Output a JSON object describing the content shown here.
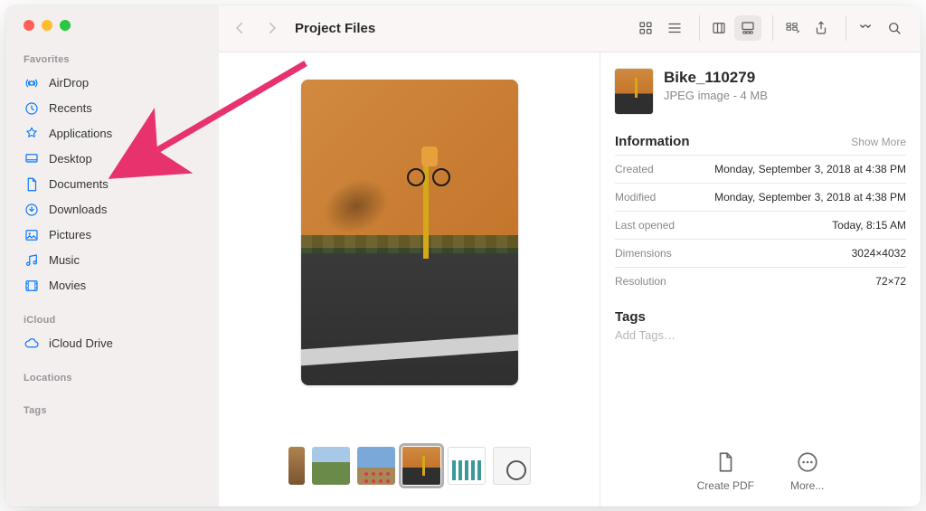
{
  "window_title": "Project Files",
  "sidebar": {
    "sections": [
      {
        "label": "Favorites",
        "items": [
          {
            "icon": "airdrop-icon",
            "label": "AirDrop"
          },
          {
            "icon": "recents-icon",
            "label": "Recents"
          },
          {
            "icon": "applications-icon",
            "label": "Applications"
          },
          {
            "icon": "desktop-icon",
            "label": "Desktop"
          },
          {
            "icon": "documents-icon",
            "label": "Documents"
          },
          {
            "icon": "downloads-icon",
            "label": "Downloads"
          },
          {
            "icon": "pictures-icon",
            "label": "Pictures"
          },
          {
            "icon": "music-icon",
            "label": "Music"
          },
          {
            "icon": "movies-icon",
            "label": "Movies"
          }
        ]
      },
      {
        "label": "iCloud",
        "items": [
          {
            "icon": "icloud-icon",
            "label": "iCloud Drive"
          }
        ]
      },
      {
        "label": "Locations",
        "items": []
      },
      {
        "label": "Tags",
        "items": []
      }
    ]
  },
  "inspector": {
    "file_name": "Bike_110279",
    "file_sub": "JPEG image - 4 MB",
    "info_heading": "Information",
    "show_more": "Show More",
    "rows": [
      {
        "k": "Created",
        "v": "Monday, September 3, 2018 at 4:38 PM"
      },
      {
        "k": "Modified",
        "v": "Monday, September 3, 2018 at 4:38 PM"
      },
      {
        "k": "Last opened",
        "v": "Today, 8:15 AM"
      },
      {
        "k": "Dimensions",
        "v": "3024×4032"
      },
      {
        "k": "Resolution",
        "v": "72×72"
      }
    ],
    "tags_heading": "Tags",
    "tags_placeholder": "Add Tags…",
    "actions": {
      "create_pdf": "Create PDF",
      "more": "More..."
    }
  },
  "annotation": {
    "type": "arrow",
    "target": "Applications"
  }
}
